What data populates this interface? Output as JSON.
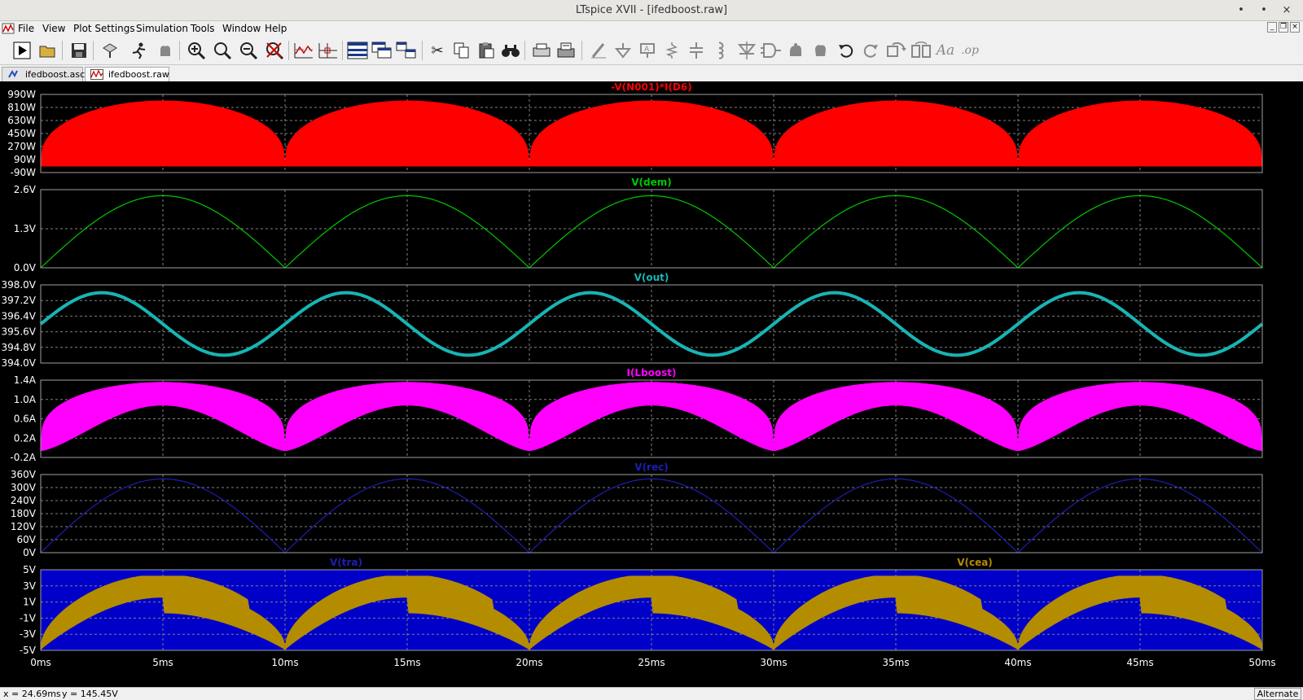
{
  "window": {
    "title": "LTspice XVII - [ifedboost.raw]",
    "minimize": "•",
    "maximize": "•",
    "close": "×"
  },
  "menu": [
    "File",
    "View",
    "Plot Settings",
    "Simulation",
    "Tools",
    "Window",
    "Help"
  ],
  "mdi_controls": [
    "_",
    "❐",
    "×"
  ],
  "toolbar": [
    {
      "icon": "run-icon"
    },
    {
      "icon": "open-icon"
    },
    {
      "icon": "save-icon"
    },
    {
      "icon": "control-panel-icon"
    },
    {
      "icon": "halt-icon"
    },
    {
      "icon": "pause-icon"
    },
    {
      "icon": "zoom-in-icon"
    },
    {
      "icon": "zoom-back-icon"
    },
    {
      "icon": "zoom-out-icon"
    },
    {
      "icon": "zoom-cancel-icon"
    },
    {
      "icon": "autorange-icon"
    },
    {
      "icon": "cursor-icon"
    },
    {
      "icon": "tile-horizontal-icon"
    },
    {
      "icon": "tile-vertical-icon"
    },
    {
      "icon": "cascade-icon"
    },
    {
      "icon": "cut-icon"
    },
    {
      "icon": "copy-icon"
    },
    {
      "icon": "paste-icon"
    },
    {
      "icon": "find-icon"
    },
    {
      "icon": "print-setup-icon"
    },
    {
      "icon": "print-icon"
    },
    {
      "icon": "wire-icon"
    },
    {
      "icon": "ground-icon"
    },
    {
      "icon": "label-icon"
    },
    {
      "icon": "resistor-icon"
    },
    {
      "icon": "capacitor-icon"
    },
    {
      "icon": "inductor-icon"
    },
    {
      "icon": "diode-icon"
    },
    {
      "icon": "component-icon"
    },
    {
      "icon": "move-icon"
    },
    {
      "icon": "drag-icon"
    },
    {
      "icon": "undo-icon"
    },
    {
      "icon": "redo-icon"
    },
    {
      "icon": "rotate-icon"
    },
    {
      "icon": "mirror-icon"
    },
    {
      "icon": "text-icon"
    },
    {
      "icon": "spice-directive-icon"
    }
  ],
  "tabs": [
    {
      "label": "ifedboost.asc",
      "icon": "schematic-icon",
      "active": false
    },
    {
      "label": "ifedboost.raw",
      "icon": "waveform-icon",
      "active": true
    }
  ],
  "colors": {
    "background": "#000000",
    "grid": "#808080",
    "axis_text": "#ffffff",
    "red": "#ff0000",
    "green": "#00c800",
    "cyan": "#19b4b4",
    "magenta": "#ff00ff",
    "blue": "#0000c8",
    "gold": "#b48c00",
    "navy": "#1e1eb4"
  },
  "chart_data": [
    {
      "type": "line",
      "title": "-V(N001)*I(D6)",
      "yticks": [
        "990W",
        "810W",
        "630W",
        "450W",
        "270W",
        "90W",
        "-90W"
      ],
      "ylim": [
        -90,
        990
      ],
      "xlim": [
        0,
        50
      ],
      "series": [
        {
          "name": "-V(N001)*I(D6)",
          "color": "#ff0000",
          "shape": "rect-sine-envelope",
          "min": 0,
          "max": 900
        }
      ]
    },
    {
      "type": "line",
      "title": "V(dem)",
      "yticks": [
        "2.6V",
        "1.3V",
        "0.0V"
      ],
      "ylim": [
        0,
        2.6
      ],
      "xlim": [
        0,
        50
      ],
      "series": [
        {
          "name": "V(dem)",
          "color": "#00c800",
          "shape": "rect-sine",
          "min": 0,
          "max": 2.4
        }
      ]
    },
    {
      "type": "line",
      "title": "V(out)",
      "yticks": [
        "398.0V",
        "397.2V",
        "396.4V",
        "395.6V",
        "394.8V",
        "394.0V"
      ],
      "ylim": [
        394.0,
        398.0
      ],
      "xlim": [
        0,
        50
      ],
      "series": [
        {
          "name": "V(out)",
          "color": "#19b4b4",
          "shape": "ripple",
          "center": 396.0,
          "amplitude": 1.6,
          "phase_ms": 2.5
        }
      ]
    },
    {
      "type": "line",
      "title": "I(Lboost)",
      "yticks": [
        "1.4A",
        "1.0A",
        "0.6A",
        "0.2A",
        "-0.2A"
      ],
      "ylim": [
        -0.2,
        1.5
      ],
      "xlim": [
        0,
        50
      ],
      "series": [
        {
          "name": "I(Lboost)",
          "color": "#ff00ff",
          "shape": "current-band",
          "low_peak": 1.0,
          "high_peak": 1.45
        }
      ]
    },
    {
      "type": "line",
      "title": "V(rec)",
      "yticks": [
        "360V",
        "300V",
        "240V",
        "180V",
        "120V",
        "60V",
        "0V"
      ],
      "ylim": [
        0,
        360
      ],
      "xlim": [
        0,
        50
      ],
      "series": [
        {
          "name": "V(rec)",
          "color": "#1e1eb4",
          "shape": "rect-sine",
          "min": 0,
          "max": 340
        }
      ]
    },
    {
      "type": "line",
      "title": "",
      "yticks": [
        "5V",
        "3V",
        "1V",
        "-1V",
        "-3V",
        "-5V"
      ],
      "ylim": [
        -5,
        5
      ],
      "xlim": [
        0,
        50
      ],
      "series": [
        {
          "name": "V(tra)",
          "color": "#0000c8",
          "shape": "triangle-carrier",
          "min": -5,
          "max": 5
        },
        {
          "name": "V(cea)",
          "color": "#b48c00",
          "shape": "control-band",
          "min": -5,
          "max": 4.2
        }
      ]
    }
  ],
  "xticks": [
    "0ms",
    "5ms",
    "10ms",
    "15ms",
    "20ms",
    "25ms",
    "30ms",
    "35ms",
    "40ms",
    "45ms",
    "50ms"
  ],
  "status": {
    "x": "x = 24.69ms",
    "y": "y = 145.45V",
    "mode": "Alternate"
  }
}
